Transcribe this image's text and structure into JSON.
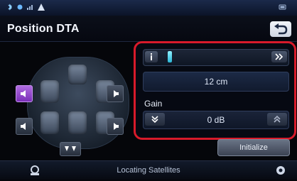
{
  "header": {
    "title": "Position DTA"
  },
  "icons": {
    "status_bar": [
      "bluetooth-icon",
      "phone-icon",
      "signal-icon",
      "warning-icon"
    ],
    "back": "return-arrow-icon",
    "speaker": "speaker-icon",
    "subwoofer": "subwoofer-icon",
    "slider_left": "info-icon",
    "slider_right": "double-chevron-right-icon",
    "gain_down": "double-chevron-down-icon",
    "gain_up": "double-chevron-up-icon",
    "bottom_left": "navigation-icon",
    "bottom_right": "settings-icon"
  },
  "position": {
    "slider_level": 0.08,
    "distance_value": "12 cm"
  },
  "gain": {
    "label": "Gain",
    "value": "0 dB"
  },
  "actions": {
    "initialize_label": "Initialize"
  },
  "footer": {
    "status": "Locating Satellites"
  },
  "colors": {
    "highlight_border": "#d81a2a",
    "selected_speaker": "#9a4fd0",
    "slider_thumb": "#2bb6d6"
  }
}
